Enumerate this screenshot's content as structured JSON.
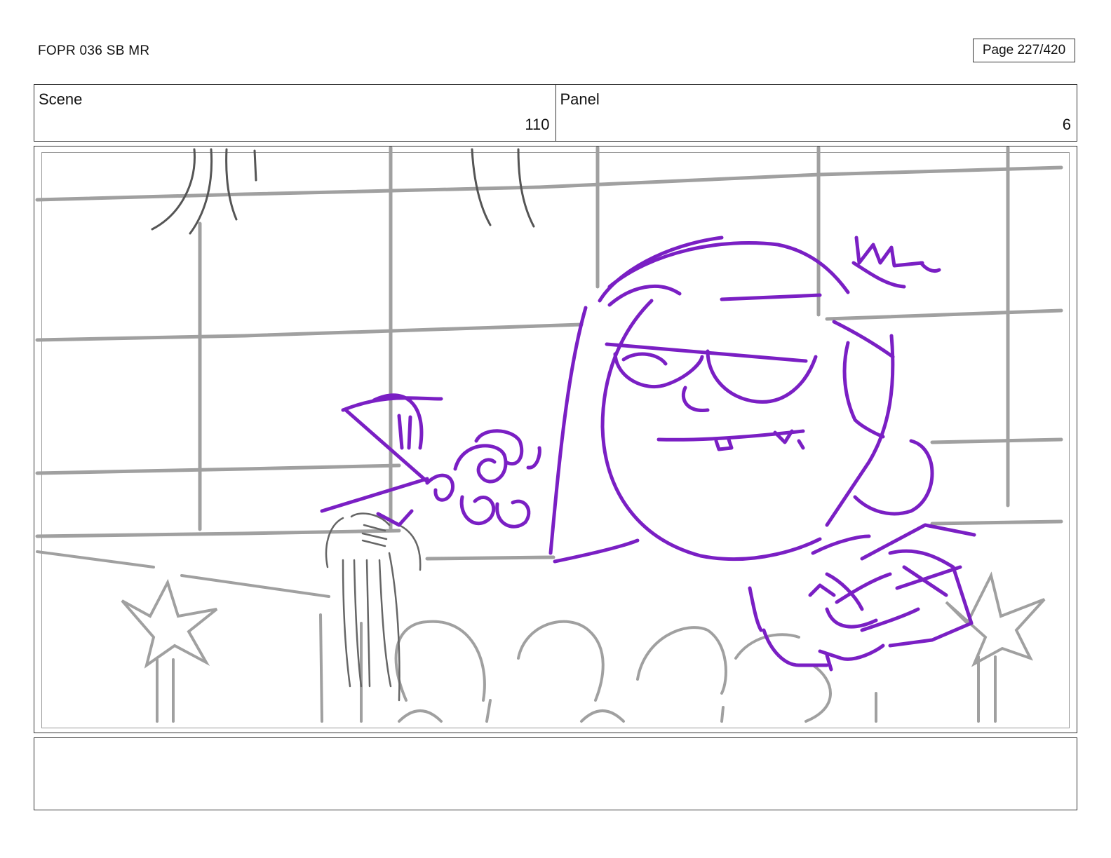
{
  "header": {
    "doc_title": "FOPR 036 SB MR",
    "page_label": "Page 227/420"
  },
  "info": {
    "scene_label": "Scene",
    "scene_value": "110",
    "panel_label": "Panel",
    "panel_value": "6"
  },
  "colors": {
    "sketch_purple": "#7a1fc4",
    "background_gray": "#a0a0a0",
    "hair_dark": "#555555"
  },
  "notes": {
    "text": ""
  }
}
